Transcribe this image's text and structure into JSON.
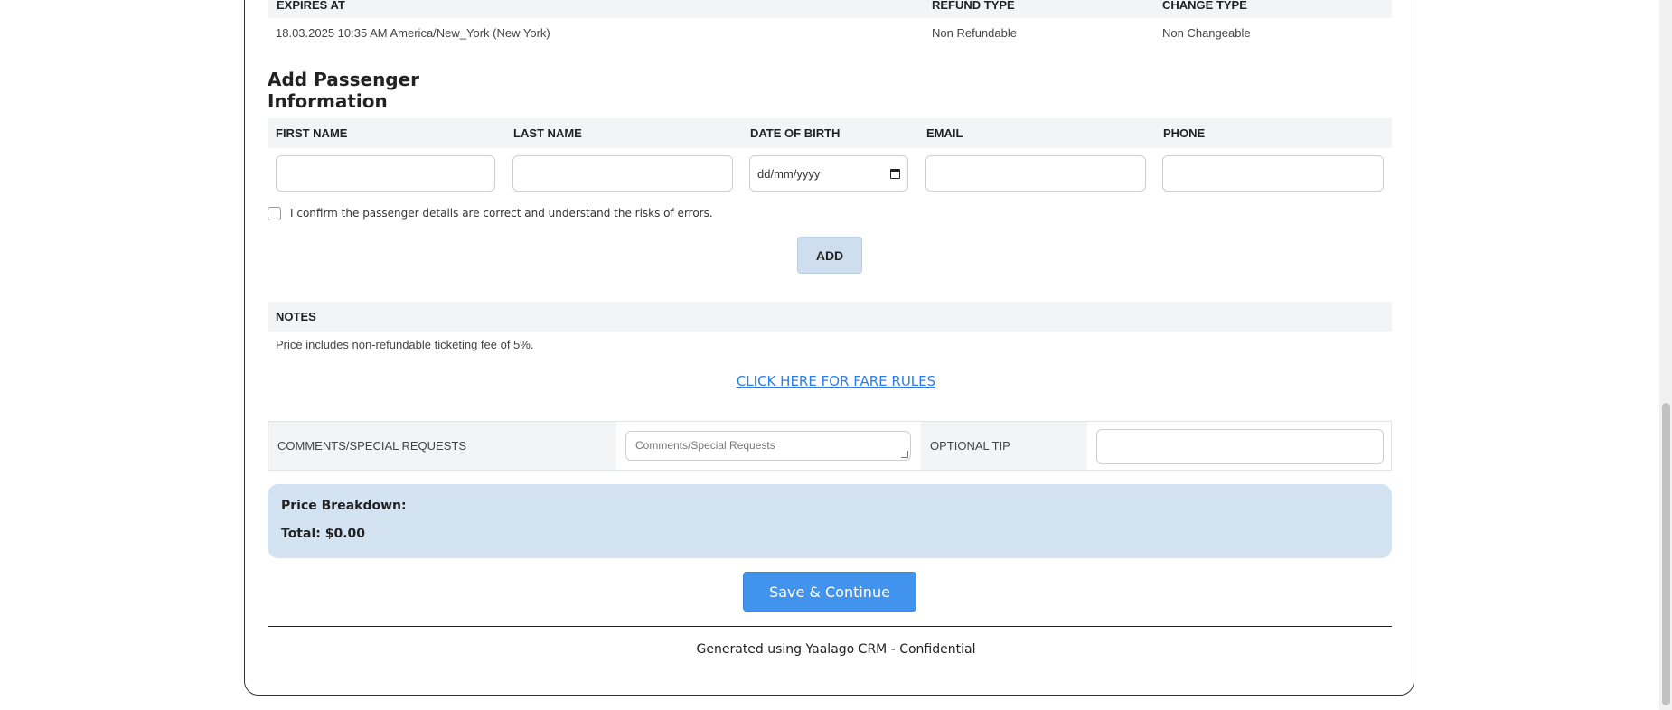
{
  "ticket": {
    "headers": [
      "EXPIRES AT",
      "REFUND TYPE",
      "CHANGE TYPE"
    ],
    "expires_at": "18.03.2025 10:35 AM America/New_York (New York)",
    "refund_type": "Non Refundable",
    "change_type": "Non Changeable"
  },
  "passenger": {
    "section_title": "Add Passenger Information",
    "columns": [
      "FIRST NAME",
      "LAST NAME",
      "DATE OF BIRTH",
      "EMAIL",
      "PHONE"
    ],
    "date_placeholder": "dd/mm/yyyy",
    "confirm_text": "I confirm the passenger details are correct and understand the risks of errors.",
    "confirm_checked": false,
    "add_label": "ADD"
  },
  "notes": {
    "header": "NOTES",
    "text": "Price includes non-refundable ticketing fee of 5%."
  },
  "fare_rules_link": "CLICK HERE FOR FARE RULES",
  "requests": {
    "comments_label": "COMMENTS/SPECIAL REQUESTS",
    "comments_placeholder": "Comments/Special Requests",
    "tip_label": "OPTIONAL TIP"
  },
  "price": {
    "breakdown_label": "Price Breakdown:",
    "total_label": "Total",
    "total_value": ": $0.00"
  },
  "save_label": "Save & Continue",
  "footer": "Generated using Yaalago CRM - Confidential",
  "colors": {
    "accent": "#4193ee",
    "link": "#2b7de9",
    "price_bg": "#d3e3f2",
    "add_bg": "#cfdeee"
  }
}
